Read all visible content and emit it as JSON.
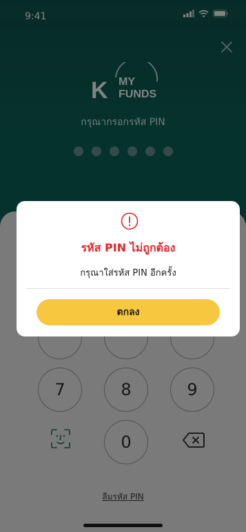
{
  "status_bar": {
    "time": "9:41"
  },
  "logo": {
    "mark": "K",
    "top_text": "MY",
    "bottom_text": "FUNDS"
  },
  "pin_prompt": "กรุณากรอกรหัส PIN",
  "keypad": {
    "keys": [
      "7",
      "8",
      "9",
      "0"
    ],
    "forgot_pin": "ลืมรหัส PIN"
  },
  "dialog": {
    "title": "รหัส PIN ไม่ถูกต้อง",
    "message": "กรุณาใส่รหัส PIN อีกครั้ง",
    "confirm_label": "ตกลง"
  },
  "colors": {
    "teal": "#0b5b52",
    "error": "#e0262b",
    "button": "#f7c83f"
  },
  "icons": [
    "signal-icon",
    "wifi-icon",
    "battery-icon",
    "close-icon",
    "alert-icon",
    "face-id-icon",
    "backspace-icon"
  ]
}
